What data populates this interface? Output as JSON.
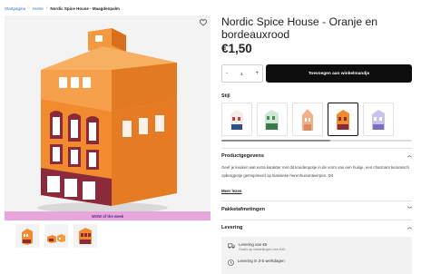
{
  "breadcrumb": {
    "items": [
      "Startpagina",
      "Home"
    ],
    "current": "Nordic Spice House - Maagdenpalm"
  },
  "product": {
    "title": "Nordic Spice House - Oranje en bordeauxrood",
    "price": "€1,50",
    "badge": "WOW of the week"
  },
  "quantity": {
    "value": "1",
    "minus": "-",
    "plus": "+"
  },
  "cart": {
    "add_label": "Toevoegen aan winkelmandje"
  },
  "style": {
    "label": "Stijl",
    "options": [
      "white-blue",
      "green",
      "peach",
      "orange-burgundy",
      "lilac"
    ],
    "selected_index": 3
  },
  "sections": {
    "details_title": "Productgegevens",
    "details_text": "Geef je keuken wat extra karakter met dit kruidenpotje in de vorm van een huisje, een charmant keramisch opbergpotje geïnspireerd op klassieke herenhuisontwerpen. Dit",
    "read_more": "Meer lezen",
    "dimensions_title": "Pakketafmetingen",
    "delivery_title": "Levering"
  },
  "delivery": {
    "line1": "Levering van €6",
    "line1_sub": "Gratis op bestellingen van €40",
    "line2": "Levering in 3-5 werkdagen"
  },
  "colors": {
    "accent": "#f08a2c",
    "burgundy": "#8b2a3a",
    "badge_bg": "#e8a6dc",
    "button_bg": "#0e0e0e"
  },
  "icons": {
    "favorite": "heart-icon",
    "truck": "truck-icon",
    "clock": "clock-icon"
  }
}
